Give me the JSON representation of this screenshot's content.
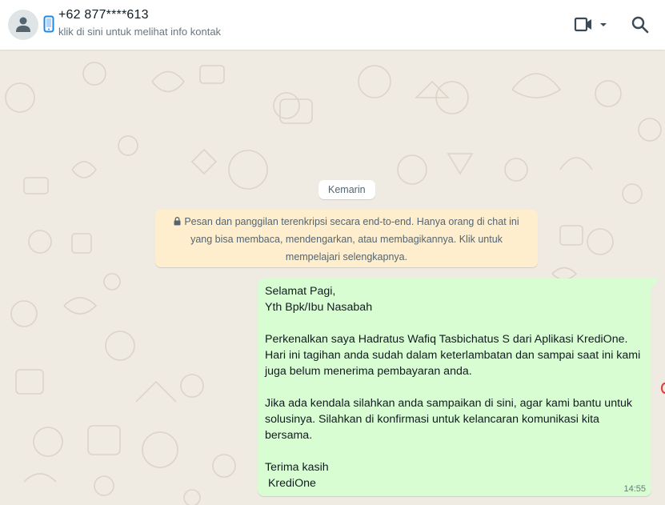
{
  "header": {
    "contact_name": "+62 877****613",
    "contact_sub": "klik di sini untuk melihat info kontak",
    "avatar_icon": "person-icon",
    "phone_icon": "mobile-phone-icon",
    "video_icon": "video-camera-icon",
    "search_icon": "search-icon"
  },
  "chat": {
    "date_label": "Kemarin",
    "e2e_notice": "Pesan dan panggilan terenkripsi secara end-to-end. Hanya orang di chat ini yang bisa membaca, mendengarkan, atau membagikannya. Klik untuk mempelajari selengkapnya.",
    "message": {
      "text": "Selamat Pagi,\nYth Bpk/Ibu Nasabah\n\nPerkenalkan saya Hadratus Wafiq Tasbichatus S dari Aplikasi KrediOne.\nHari ini tagihan anda sudah dalam keterlambatan dan sampai saat ini kami juga belum menerima pembayaran anda.\n\nJika ada kendala silahkan anda sampaikan di sini, agar kami bantu untuk solusinya. Silahkan di konfirmasi untuk kelancaran komunikasi kita bersama.\n\nTerima kasih\n KrediOne",
      "time": "14:55"
    }
  },
  "colors": {
    "header_bg": "#ffffff",
    "chat_bg": "#efeae2",
    "outgoing_bubble": "#d9fdd3",
    "notice_bg": "#ffeecd",
    "phone_icon_color": "#1e88e5"
  }
}
